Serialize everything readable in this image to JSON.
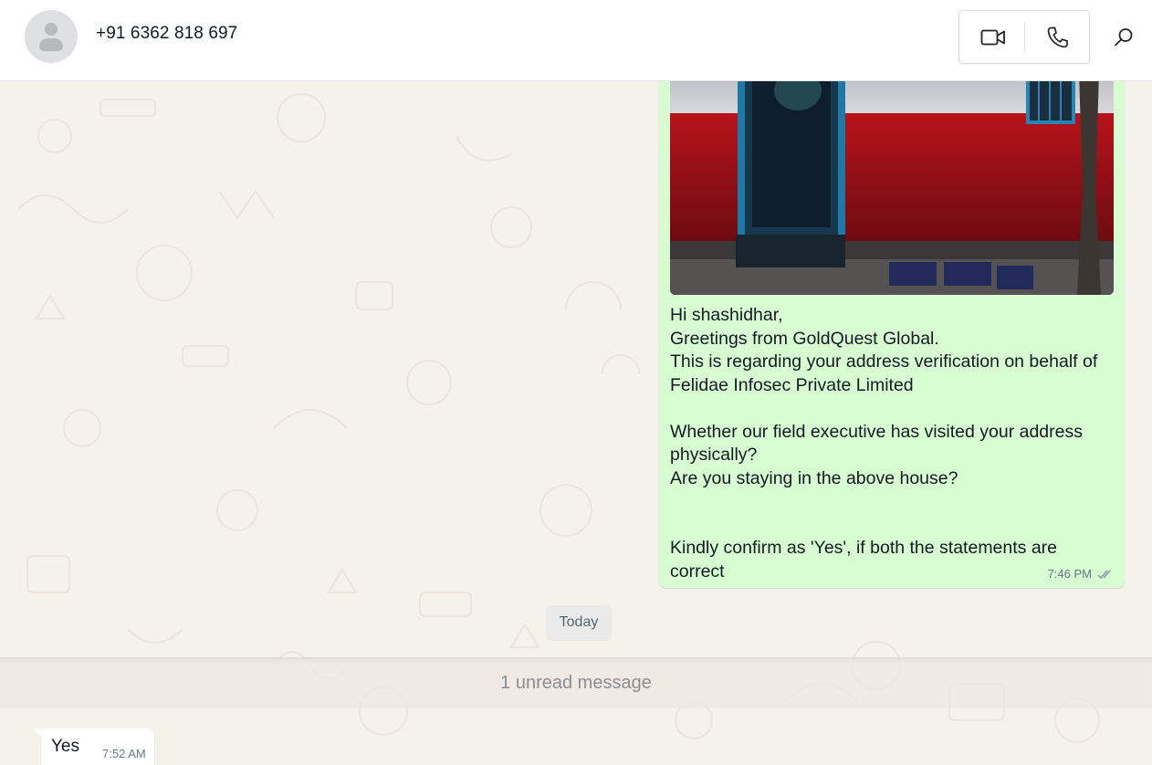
{
  "header": {
    "contact_name": "+91 6362 818 697",
    "avatar_icon": "default-person-avatar",
    "video_icon": "video-camera-icon",
    "phone_icon": "phone-icon",
    "search_icon": "search-icon"
  },
  "messages": {
    "outgoing": {
      "image_description_icon": "photo-attachment",
      "text": "Hi shashidhar,\nGreetings from GoldQuest Global.\nThis is regarding your address verification on behalf of Felidae Infosec Private Limited\n\nWhether our field executive has visited your address physically?\nAre you staying in the above house?\n\n\nKindly confirm as 'Yes', if both the statements are correct",
      "time": "7:46 PM",
      "status_icon": "double-check-icon"
    },
    "date_divider": "Today",
    "unread_banner": "1 unread message",
    "incoming": {
      "text": "Yes",
      "time": "7:52 AM"
    }
  },
  "colors": {
    "outgoing_bubble": "#d9fdd3",
    "incoming_bubble": "#ffffff",
    "wallpaper": "#f5f1eb"
  }
}
